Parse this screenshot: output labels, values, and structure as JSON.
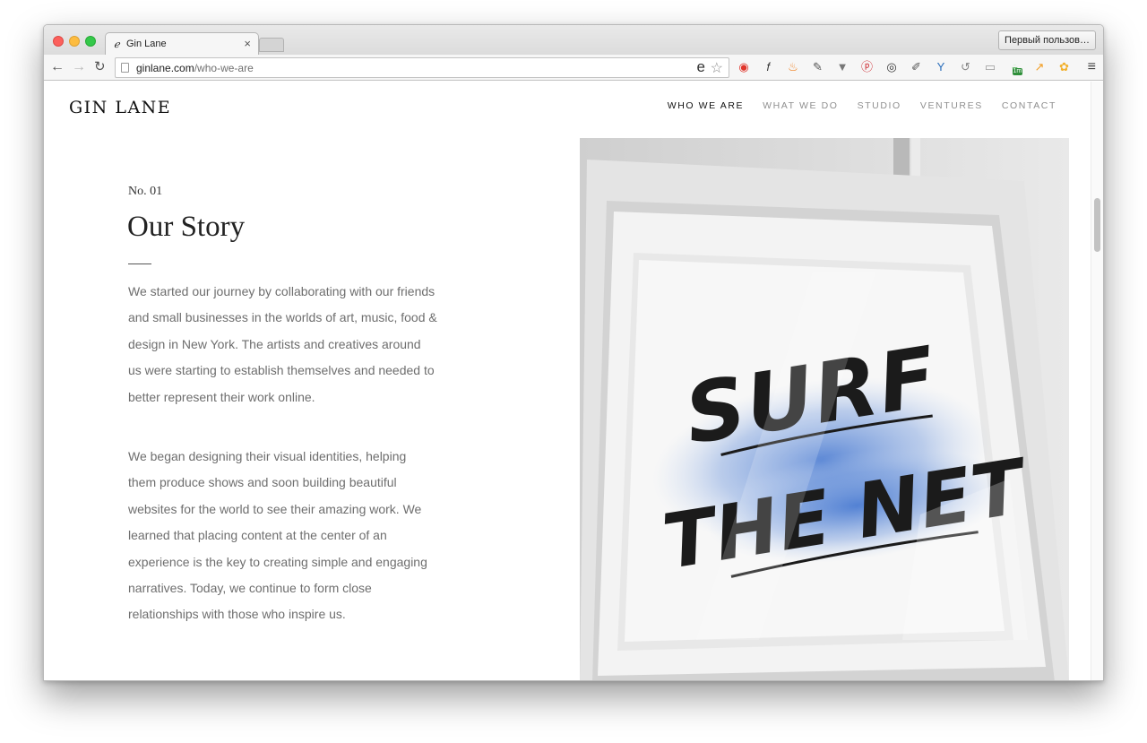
{
  "browser": {
    "tab_title": "Gin Lane",
    "tab_close": "×",
    "profile_button": "Первый пользов…",
    "url_host": "ginlane.com",
    "url_path": "/who-we-are",
    "back": "←",
    "forward": "→",
    "reload": "↻",
    "star": "☆",
    "menu": "≡",
    "extensions": [
      {
        "name": "adblock-icon",
        "color": "#e0352b"
      },
      {
        "name": "font-identifier-icon",
        "color": "#333333"
      },
      {
        "name": "fire-icon",
        "color": "#f07d1a"
      },
      {
        "name": "evernote-icon",
        "color": "#555555"
      },
      {
        "name": "pocket-icon",
        "color": "#777777"
      },
      {
        "name": "pinterest-icon",
        "color": "#cb2027"
      },
      {
        "name": "camera-icon",
        "color": "#333333"
      },
      {
        "name": "eyedropper-icon",
        "color": "#555555"
      },
      {
        "name": "yandex-icon",
        "color": "#2a6ebb"
      },
      {
        "name": "sync-icon",
        "color": "#888888"
      },
      {
        "name": "reader-icon",
        "color": "#999999"
      },
      {
        "name": "meter-icon",
        "color": "#4caf50",
        "badge": "1m"
      },
      {
        "name": "analytics-icon",
        "color": "#f29c1f"
      },
      {
        "name": "flower-icon",
        "color": "#f2b02b"
      }
    ]
  },
  "site": {
    "logo": "GIN LANE",
    "nav": [
      "WHO WE ARE",
      "WHAT WE DO",
      "STUDIO",
      "VENTURES",
      "CONTACT"
    ],
    "active_nav": "WHO WE ARE"
  },
  "content": {
    "kicker": "No. 01",
    "heading": "Our Story",
    "paragraph1": "We started our journey by collaborating with our friends and small businesses in the worlds of art, music, food & design in New York. The artists and creatives around us were starting to establish themselves and needed to better represent their work online.",
    "paragraph2": "We began designing their visual identities, helping them produce shows and soon building beautiful websites for the world to see their amazing work. We learned that placing content at the center of an experience is the key to creating simple and engaging narratives. Today, we continue to form close relationships with those who inspire us.",
    "artwork_text_line1": "SURF",
    "artwork_text_line2": "THE NET"
  }
}
